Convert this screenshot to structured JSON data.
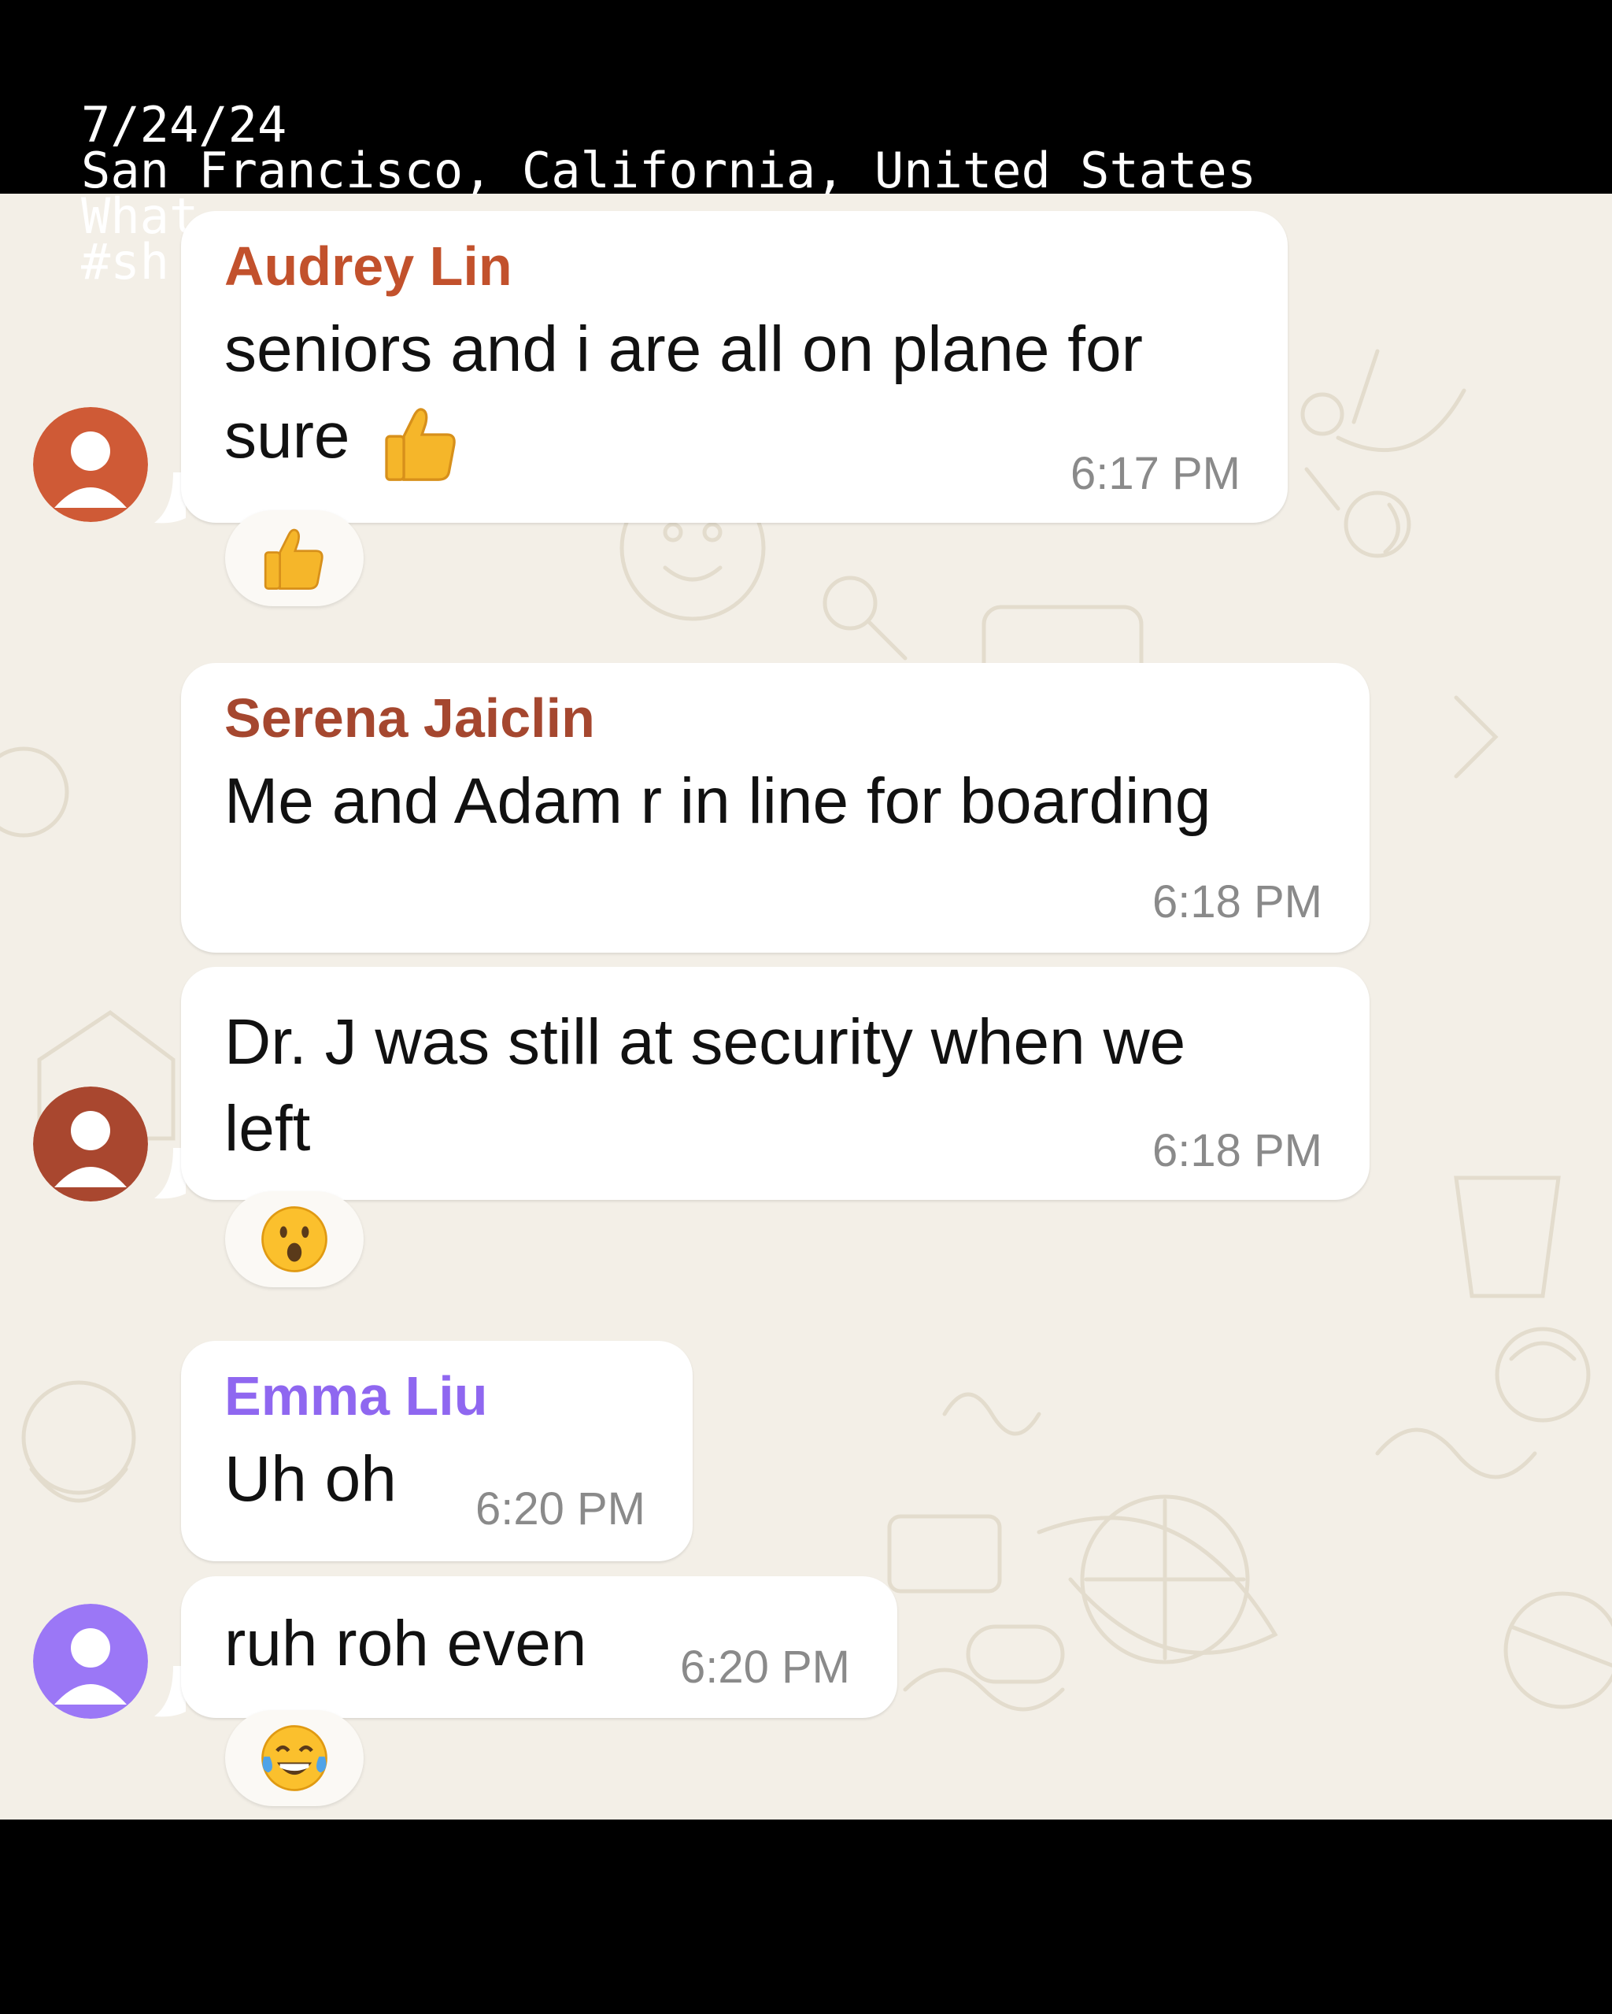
{
  "overlay": {
    "date": "7/24/24",
    "location": "San Francisco, California, United States",
    "line3": "What",
    "line4": "#sh"
  },
  "messages": [
    {
      "sender": "Audrey Lin",
      "sender_color": "#c2512c",
      "lines": [
        "seniors and i are all on plane for",
        "sure"
      ],
      "inline_emoji": "thumbs-up",
      "time": "6:17 PM",
      "reaction": "thumbs-up",
      "avatar_color": "#cf5a36"
    },
    {
      "sender": "Serena Jaiclin",
      "sender_color": "#a5472f",
      "lines": [
        "Me and Adam r in line for boarding"
      ],
      "time": "6:18 PM"
    },
    {
      "lines": [
        "Dr. J was still at security when we",
        "left"
      ],
      "time": "6:18 PM",
      "reaction": "face-with-open-mouth",
      "avatar_color": "#a9472f"
    },
    {
      "sender": "Emma Liu",
      "sender_color": "#8f67f0",
      "lines": [
        "Uh oh"
      ],
      "time": "6:20 PM"
    },
    {
      "lines": [
        "ruh roh even"
      ],
      "time": "6:20 PM",
      "reaction": "face-with-tears-of-joy",
      "avatar_color": "#9b77f6"
    }
  ]
}
